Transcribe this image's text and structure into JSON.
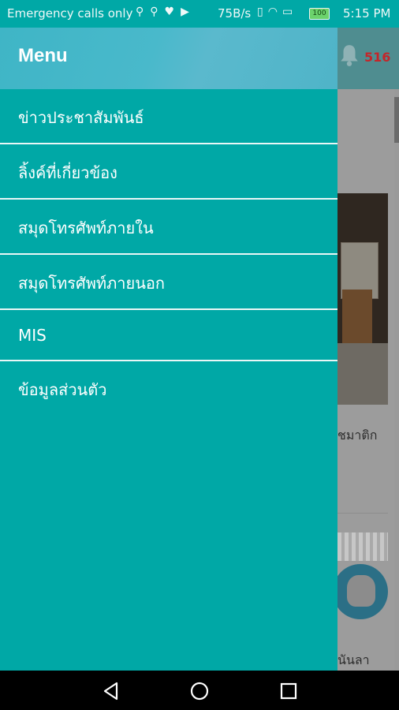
{
  "status_bar": {
    "carrier": "Emergency calls only",
    "speed": "75B/s",
    "battery": "100",
    "time": "5:15 PM",
    "icons": [
      "usb-icon",
      "usb-icon",
      "heart-icon",
      "play-icon",
      "vibrate-icon",
      "wifi-icon",
      "sim-icon",
      "battery-icon"
    ]
  },
  "drawer": {
    "title": "Menu",
    "items": [
      {
        "label": "ข่าวประชาสัมพันธ์"
      },
      {
        "label": "ลิ้งค์ที่เกี่ยวข้อง"
      },
      {
        "label": "สมุดโทรศัพท์ภายใน"
      },
      {
        "label": "สมุดโทรศัพท์ภายนอก"
      },
      {
        "label": "MIS"
      },
      {
        "label": "ข้อมูลส่วนตัว"
      }
    ]
  },
  "background": {
    "notification_count": "516",
    "snippet_1": "ชมาติก",
    "snippet_2": "นันลา"
  },
  "colors": {
    "drawer_background": "#00a8a6",
    "header_background": "#49b9cb",
    "badge_count": "#c4262a"
  },
  "navigation_bar": {
    "icons": [
      "back-icon",
      "home-icon",
      "recents-icon"
    ]
  }
}
